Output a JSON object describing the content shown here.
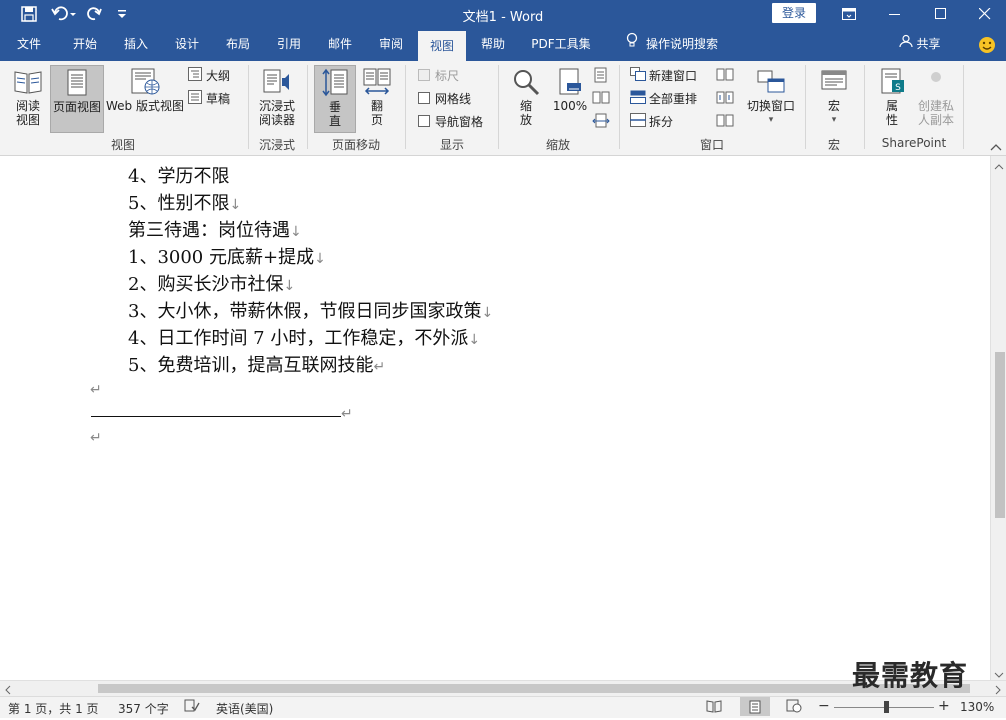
{
  "window": {
    "title": "文档1  -  Word",
    "login_label": "登录"
  },
  "tabs": [
    "文件",
    "开始",
    "插入",
    "设计",
    "布局",
    "引用",
    "邮件",
    "审阅",
    "视图",
    "帮助",
    "PDF工具集",
    "操作说明搜索"
  ],
  "active_tab": "视图",
  "share_label": "共享",
  "ribbon": {
    "views": {
      "read_mode": "阅读\n视图",
      "print_layout": "页面视图",
      "web_layout": "Web 版式视图",
      "outline": "大纲",
      "draft": "草稿",
      "label": "视图"
    },
    "immersive": {
      "reader": "沉浸式\n阅读器",
      "label": "沉浸式"
    },
    "page_movement": {
      "vertical": "垂\n直",
      "side_to_side": "翻\n页",
      "label": "页面移动"
    },
    "show": {
      "ruler": "标尺",
      "gridlines": "网格线",
      "nav_pane": "导航窗格",
      "label": "显示"
    },
    "zoom": {
      "zoom": "缩\n放",
      "hundred": "100%",
      "label": "缩放"
    },
    "window": {
      "new_window": "新建窗口",
      "arrange_all": "全部重排",
      "split": "拆分",
      "switch_windows": "切换窗口",
      "label": "窗口"
    },
    "macros": {
      "macros": "宏",
      "label": "宏"
    },
    "sharepoint": {
      "properties": "属\n性",
      "private_copy": "创建私\n人副本",
      "label": "SharePoint"
    }
  },
  "document": {
    "lines": [
      {
        "text": "4、学历不限",
        "mark": ""
      },
      {
        "text": "5、性别不限",
        "mark": "↓"
      },
      {
        "text": "第三待遇：岗位待遇",
        "mark": "↓"
      },
      {
        "text": "1、3000 元底薪+提成",
        "mark": "↓"
      },
      {
        "text": "2、购买长沙市社保",
        "mark": "↓"
      },
      {
        "text": "3、大小休，带薪休假，节假日同步国家政策",
        "mark": "↓"
      },
      {
        "text": "4、日工作时间 7 小时，工作稳定，不外派",
        "mark": "↓"
      },
      {
        "text": "5、免费培训，提高互联网技能",
        "mark": "↵"
      }
    ],
    "para_mark": "↵"
  },
  "status": {
    "page": "第 1 页，共 1 页",
    "words": "357 个字",
    "language": "英语(美国)",
    "zoom": "130%"
  },
  "watermark": "最需教育",
  "colors": {
    "brand": "#2b579a",
    "ribbon_bg": "#f3f3f3"
  }
}
